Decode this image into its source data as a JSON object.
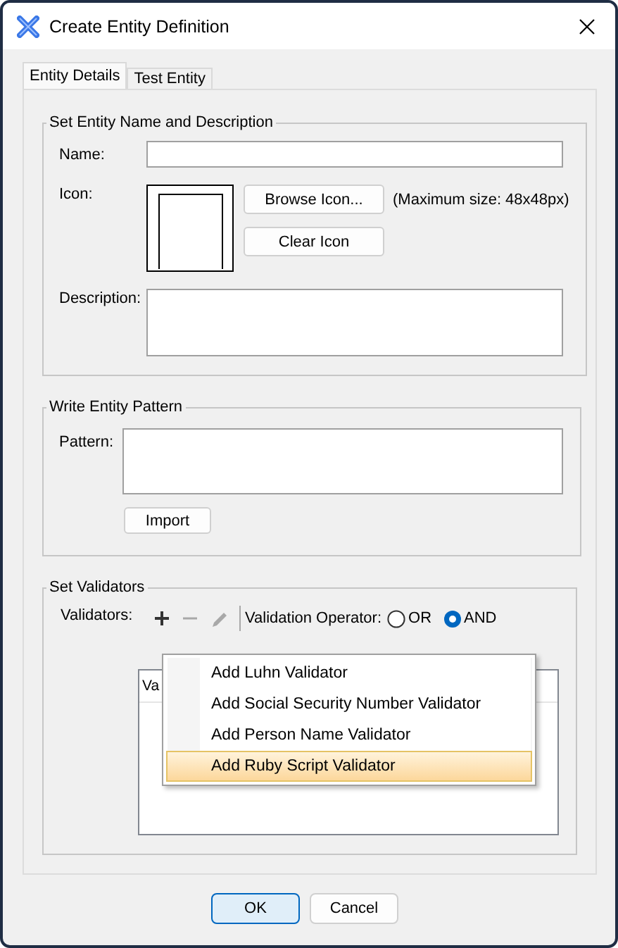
{
  "window": {
    "title": "Create Entity Definition"
  },
  "tabs": [
    {
      "label": "Entity Details",
      "selected": true
    },
    {
      "label": "Test Entity",
      "selected": false
    }
  ],
  "name_group": {
    "title": "Set Entity Name and Description",
    "name_label": "Name:",
    "icon_label": "Icon:",
    "browse_button": "Browse Icon...",
    "clear_button": "Clear Icon",
    "size_hint": "(Maximum size: 48x48px)",
    "description_label": "Description:"
  },
  "pattern_group": {
    "title": "Write Entity Pattern",
    "pattern_label": "Pattern:",
    "import_button": "Import"
  },
  "validators_group": {
    "title": "Set Validators",
    "validators_label": "Validators:",
    "tools": [
      {
        "kind": "add",
        "disabled": false
      },
      {
        "kind": "remove",
        "disabled": true
      },
      {
        "kind": "edit",
        "disabled": true
      }
    ],
    "operator_label": "Validation Operator:",
    "operators": [
      {
        "label": "OR",
        "selected": false
      },
      {
        "label": "AND",
        "selected": true
      }
    ],
    "table": {
      "columns": [
        "Va"
      ]
    }
  },
  "menu": {
    "items": [
      {
        "label": "Add Luhn Validator",
        "selected": false
      },
      {
        "label": "Add Social Security Number Validator",
        "selected": false
      },
      {
        "label": "Add Person Name Validator",
        "selected": false
      },
      {
        "label": "Add Ruby Script Validator",
        "selected": true
      }
    ]
  },
  "buttons": [
    {
      "label": "OK",
      "default": true
    },
    {
      "label": "Cancel",
      "default": false
    }
  ]
}
